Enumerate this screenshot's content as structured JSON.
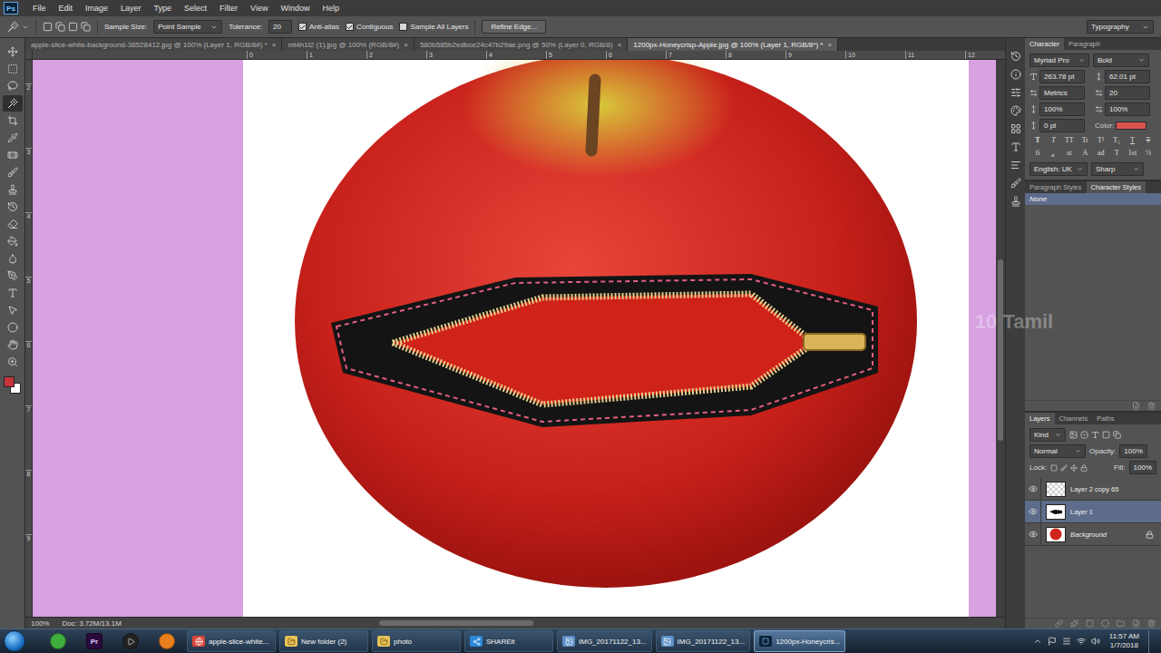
{
  "app": {
    "logo": "Ps"
  },
  "menu": [
    "File",
    "Edit",
    "Image",
    "Layer",
    "Type",
    "Select",
    "Filter",
    "View",
    "Window",
    "Help"
  ],
  "options": {
    "sample_size_label": "Sample Size:",
    "sample_size": "Point Sample",
    "tolerance_label": "Tolerance:",
    "tolerance": "20",
    "checks": [
      {
        "label": "Anti-alias",
        "checked": true
      },
      {
        "label": "Contiguous",
        "checked": true
      },
      {
        "label": "Sample All Layers",
        "checked": false
      }
    ],
    "refine_button": "Refine Edge...",
    "workspace": "Typography"
  },
  "tabs": [
    {
      "label": "apple-slice-white-background-36528412.jpg @ 100% (Layer 1, RGB/8#) *",
      "close": "×",
      "selected": false
    },
    {
      "label": "mt4h1t2 (1).jpg @ 100% (RGB/8#)",
      "close": "×",
      "selected": false
    },
    {
      "label": "580b585b2edbce24c47b29ae.png @ 50% (Layer 0, RGB/8)",
      "close": "×",
      "selected": false
    },
    {
      "label": "1200px-Honeycrisp-Apple.jpg @ 100% (Layer 1, RGB/8*) *",
      "close": "×",
      "selected": true
    }
  ],
  "tools": [
    {
      "selected": false
    },
    {
      "selected": false
    },
    {
      "selected": false
    },
    {
      "selected": true
    },
    {
      "selected": false
    },
    {
      "selected": false
    },
    {
      "selected": false
    },
    {
      "selected": false
    },
    {
      "selected": false
    },
    {
      "selected": false
    },
    {
      "selected": false
    },
    {
      "selected": false
    },
    {
      "selected": false
    },
    {
      "selected": false
    },
    {
      "selected": false
    },
    {
      "selected": false
    },
    {
      "selected": false
    },
    {
      "selected": false
    },
    {
      "selected": false
    }
  ],
  "colors": {
    "foreground": "#c8343c",
    "background": "#ffffff"
  },
  "rulers": {
    "top": [
      "0",
      "1",
      "2",
      "3",
      "4",
      "5",
      "6",
      "7",
      "8",
      "9",
      "10",
      "11",
      "12"
    ],
    "left": [
      "2",
      "3",
      "4",
      "5",
      "6",
      "7",
      "8",
      "9"
    ]
  },
  "canvas": {
    "watermark": "Top 10 Tamil"
  },
  "status": {
    "zoom": "100%",
    "doc": "Doc: 3.72M/13.1M"
  },
  "character": {
    "tabs": [
      {
        "label": "Character",
        "selected": true
      },
      {
        "label": "Paragraph",
        "selected": false
      }
    ],
    "font": "Myriad Pro",
    "style": "Bold",
    "size": "263.78 pt",
    "leading": "62.01 pt",
    "kerning": "Metrics",
    "tracking": "20",
    "vertical_scale": "100%",
    "horizontal_scale": "100%",
    "baseline": "0 pt",
    "color_label": "Color:",
    "color": "#d9534f",
    "type_buttons": [
      "T",
      "T",
      "TT",
      "Tr",
      "T¹",
      "T₁",
      "T",
      "T"
    ],
    "opentype_buttons": [
      "fi",
      "ℴ",
      "st",
      "A",
      "ad",
      "T",
      "1st",
      "½"
    ],
    "language": "English: UK",
    "antialias": "Sharp"
  },
  "styles": {
    "tabs": [
      {
        "label": "Paragraph Styles",
        "selected": false
      },
      {
        "label": "Character Styles",
        "selected": true
      }
    ],
    "items": [
      {
        "label": "None",
        "selected": true
      }
    ]
  },
  "layers": {
    "tabs": [
      {
        "label": "Layers",
        "selected": true
      },
      {
        "label": "Channels",
        "selected": false
      },
      {
        "label": "Paths",
        "selected": false
      }
    ],
    "filter": "Kind",
    "blend": "Normal",
    "opacity_label": "Opacity:",
    "opacity": "100%",
    "lock_label": "Lock:",
    "fill_label": "Fill:",
    "fill": "100%",
    "items": [
      {
        "name": "Layer 2 copy 65",
        "kind": "empty",
        "visible": true,
        "locked": false,
        "selected": false
      },
      {
        "name": "Layer 1",
        "kind": "outline",
        "visible": true,
        "locked": false,
        "selected": true
      },
      {
        "name": "Background",
        "kind": "photo",
        "visible": true,
        "locked": true,
        "selected": false
      }
    ]
  },
  "taskbar": {
    "pinned": [
      {
        "kind": "utorrent"
      },
      {
        "kind": "premiere",
        "label": "Pr"
      },
      {
        "kind": "media"
      },
      {
        "kind": "firefox"
      }
    ],
    "windows": [
      {
        "label": "apple-slice-white...",
        "kind": "chrome",
        "selected": false
      },
      {
        "label": "New folder (2)",
        "kind": "folder",
        "selected": false
      },
      {
        "label": "photo",
        "kind": "folder",
        "selected": false
      },
      {
        "label": "SHAREit",
        "kind": "shareit",
        "selected": false
      },
      {
        "label": "IMG_20171122_13...",
        "kind": "photo",
        "selected": false
      },
      {
        "label": "IMG_20171122_13...",
        "kind": "photo",
        "selected": false
      },
      {
        "label": "1200px-Honeycris...",
        "kind": "photoshop",
        "selected": true
      }
    ],
    "time": "11:57 AM",
    "date": "1/7/2018"
  }
}
